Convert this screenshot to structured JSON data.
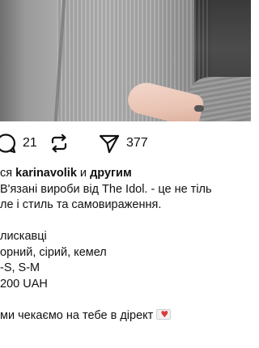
{
  "post": {
    "actions": {
      "comments_count": "21",
      "reposts_count": "",
      "shares_count": "377"
    },
    "likes": {
      "prefix": "ся ",
      "user": "karinavolik",
      "conjunction": " и ",
      "others": "другим"
    },
    "caption": {
      "line1": "В'язані вироби від The Idol. - це не тіль",
      "line2": "ле і стиль та самовираження.",
      "line3": "",
      "line4": "лискавці",
      "line5": "орний, сірий, кемел",
      "line6": "-S, S-M",
      "line7": "200 UAH",
      "line8": "",
      "line9": "ми чекаємо на тебе в дірект"
    },
    "colors": {
      "accent_heart": "#d9383b",
      "text": "#111111"
    }
  }
}
